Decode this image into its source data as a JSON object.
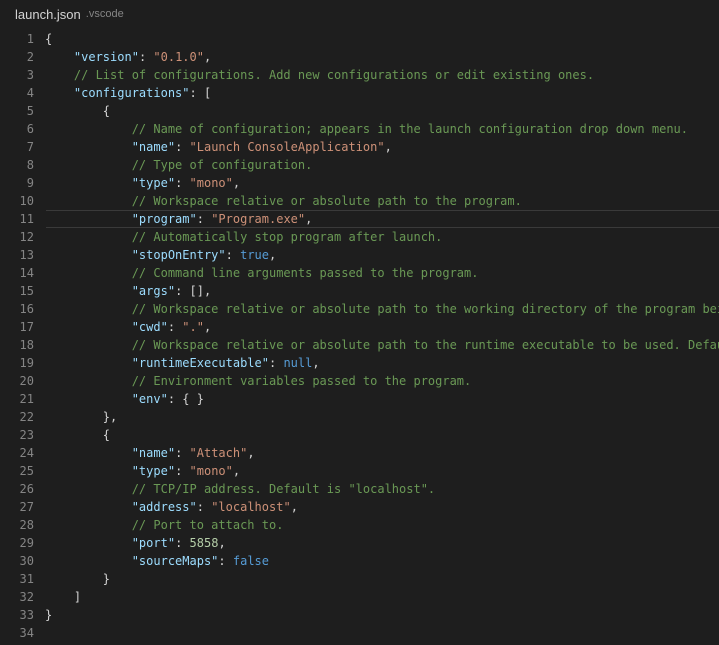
{
  "tab": {
    "filename": "launch.json",
    "folder": ".vscode"
  },
  "lines": [
    {
      "num": "1",
      "text": "{"
    },
    {
      "num": "2",
      "text": "    \"version\": \"0.1.0\","
    },
    {
      "num": "3",
      "text": "    // List of configurations. Add new configurations or edit existing ones."
    },
    {
      "num": "4",
      "text": "    \"configurations\": ["
    },
    {
      "num": "5",
      "text": "        {"
    },
    {
      "num": "6",
      "text": "            // Name of configuration; appears in the launch configuration drop down menu."
    },
    {
      "num": "7",
      "text": "            \"name\": \"Launch ConsoleApplication\","
    },
    {
      "num": "8",
      "text": "            // Type of configuration."
    },
    {
      "num": "9",
      "text": "            \"type\": \"mono\","
    },
    {
      "num": "10",
      "text": "            // Workspace relative or absolute path to the program."
    },
    {
      "num": "11",
      "text": "            \"program\": \"Program.exe\","
    },
    {
      "num": "12",
      "text": "            // Automatically stop program after launch."
    },
    {
      "num": "13",
      "text": "            \"stopOnEntry\": true,"
    },
    {
      "num": "14",
      "text": "            // Command line arguments passed to the program."
    },
    {
      "num": "15",
      "text": "            \"args\": [],"
    },
    {
      "num": "16",
      "text": "            // Workspace relative or absolute path to the working directory of the program bei"
    },
    {
      "num": "17",
      "text": "            \"cwd\": \".\","
    },
    {
      "num": "18",
      "text": "            // Workspace relative or absolute path to the runtime executable to be used. Defau"
    },
    {
      "num": "19",
      "text": "            \"runtimeExecutable\": null,"
    },
    {
      "num": "20",
      "text": "            // Environment variables passed to the program."
    },
    {
      "num": "21",
      "text": "            \"env\": { }"
    },
    {
      "num": "22",
      "text": "        },"
    },
    {
      "num": "23",
      "text": "        {"
    },
    {
      "num": "24",
      "text": "            \"name\": \"Attach\","
    },
    {
      "num": "25",
      "text": "            \"type\": \"mono\","
    },
    {
      "num": "26",
      "text": "            // TCP/IP address. Default is \"localhost\"."
    },
    {
      "num": "27",
      "text": "            \"address\": \"localhost\","
    },
    {
      "num": "28",
      "text": "            // Port to attach to."
    },
    {
      "num": "29",
      "text": "            \"port\": 5858,"
    },
    {
      "num": "30",
      "text": "            \"sourceMaps\": false"
    },
    {
      "num": "31",
      "text": "        }"
    },
    {
      "num": "32",
      "text": "    ]"
    },
    {
      "num": "33",
      "text": "}"
    },
    {
      "num": "34",
      "text": ""
    }
  ],
  "current_line": 11,
  "colors": {
    "background": "#1e1e1e",
    "line_number": "#858585",
    "key": "#9cdcfe",
    "string": "#ce9178",
    "comment": "#6a9955",
    "number": "#b5cea8",
    "keyword": "#569cd6",
    "punctuation": "#d4d4d4"
  }
}
